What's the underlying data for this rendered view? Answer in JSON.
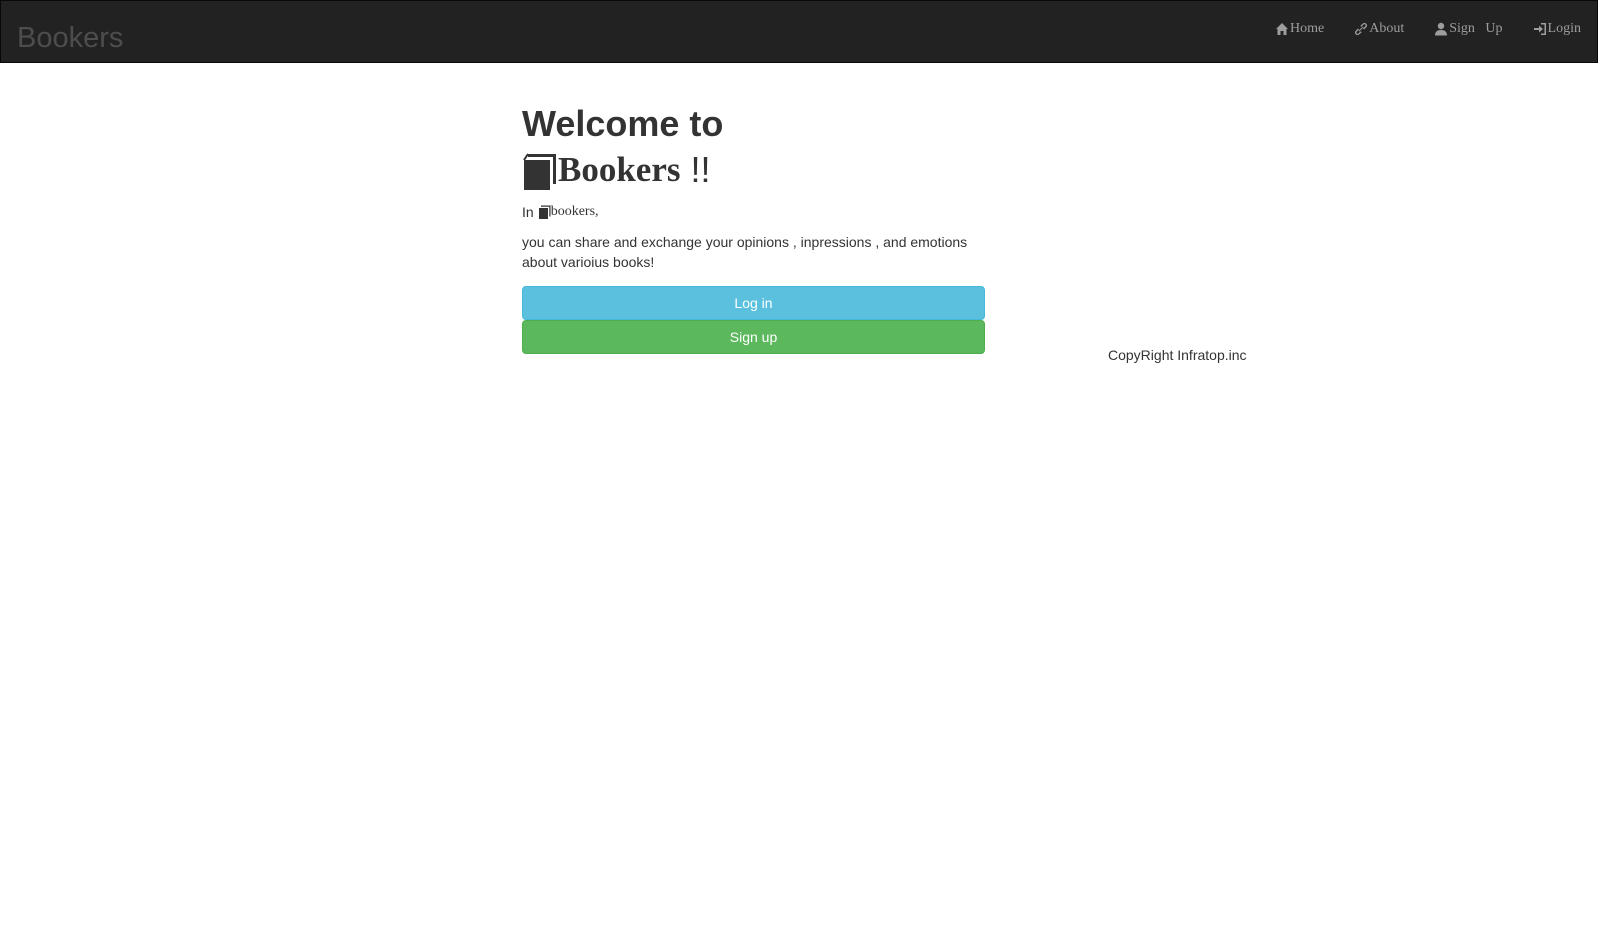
{
  "navbar": {
    "brand": "Bookers",
    "items": [
      {
        "label": "Home",
        "icon": "home-icon"
      },
      {
        "label": "About",
        "icon": "link-icon"
      },
      {
        "label": "Sign   Up",
        "icon": "user-icon"
      },
      {
        "label": "Login",
        "icon": "log-in-icon"
      }
    ]
  },
  "main": {
    "welcome_line1": "Welcome to",
    "welcome_brand": "Bookers",
    "welcome_bang": "!!",
    "in_word": "In",
    "in_brand": "bookers,",
    "description": "you can share and exchange your opinions , inpressions , and emotions about varioius books!",
    "login_button": "Log in",
    "signup_button": "Sign up"
  },
  "footer": {
    "copyright": "CopyRight Infratop.inc"
  },
  "colors": {
    "navbar_bg": "#222222",
    "login_button": "#5bc0de",
    "signup_button": "#5cb85c"
  }
}
